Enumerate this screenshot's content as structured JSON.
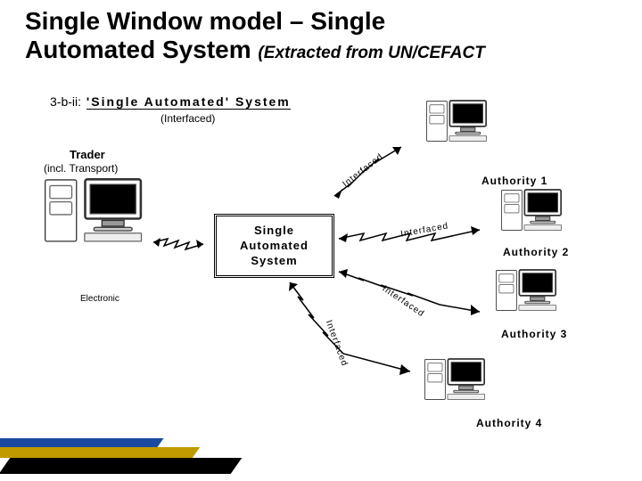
{
  "title_line1": "Single Window model – Single",
  "title_line2_main": "Automated System",
  "title_line2_sub": "(Extracted from UN/CEFACT",
  "section_prefix": "3-b-ii:",
  "section_name": "'Single Automated' System",
  "section_sub": "(Interfaced)",
  "trader": "Trader",
  "trader_sub": "(incl. Transport)",
  "electronic": "Electronic",
  "sas_line1": "Single",
  "sas_line2": "Automated",
  "sas_line3": "System",
  "auth1": "Authority 1",
  "auth2": "Authority 2",
  "auth3": "Authority 3",
  "auth4": "Authority 4",
  "interfaced": "Interfaced"
}
